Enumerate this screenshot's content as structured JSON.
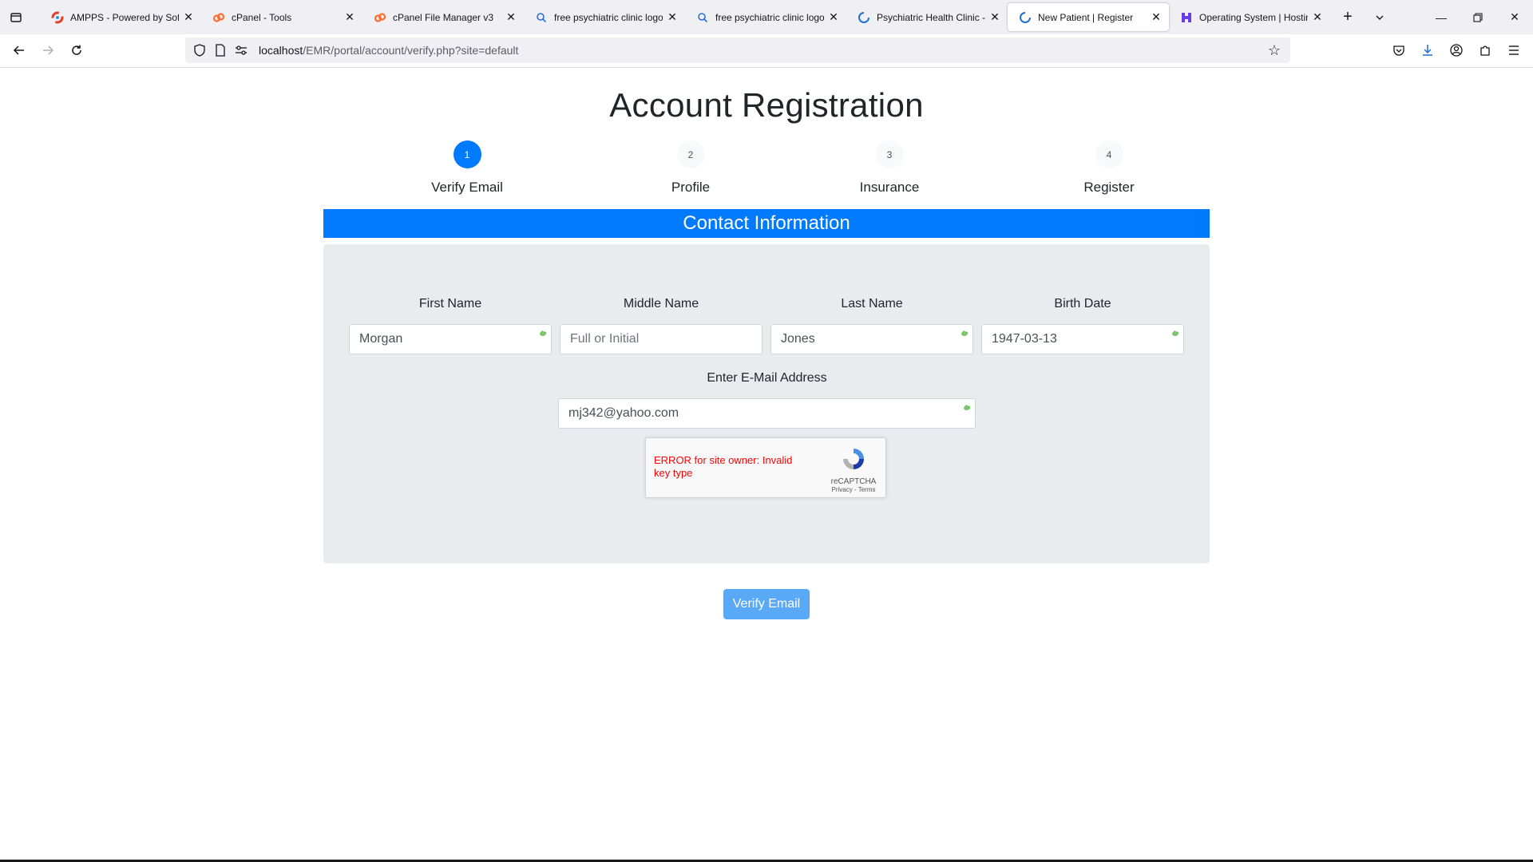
{
  "browser": {
    "tabs": [
      {
        "title": "AMPPS - Powered by Softa",
        "icon": "ampps-icon",
        "active": false
      },
      {
        "title": "cPanel - Tools",
        "icon": "cpanel-icon",
        "active": false
      },
      {
        "title": "cPanel File Manager v3",
        "icon": "cpanel-icon",
        "active": false
      },
      {
        "title": "free psychiatric clinic logo -",
        "icon": "search-icon",
        "active": false
      },
      {
        "title": "free psychiatric clinic logo -",
        "icon": "search-icon",
        "active": false
      },
      {
        "title": "Psychiatric Health Clinic - M",
        "icon": "loading-icon",
        "active": false
      },
      {
        "title": "New Patient | Register",
        "icon": "loading-icon",
        "active": true
      },
      {
        "title": "Operating System | Hosting",
        "icon": "hostinger-icon",
        "active": false
      }
    ],
    "url_host": "localhost",
    "url_path": "/EMR/portal/account/verify.php?site=default"
  },
  "page": {
    "title": "Account Registration",
    "steps": [
      {
        "number": "1",
        "label": "Verify Email",
        "active": true
      },
      {
        "number": "2",
        "label": "Profile",
        "active": false
      },
      {
        "number": "3",
        "label": "Insurance",
        "active": false
      },
      {
        "number": "4",
        "label": "Register",
        "active": false
      }
    ],
    "section_header": "Contact Information",
    "fields": {
      "first_name": {
        "label": "First Name",
        "value": "Morgan",
        "placeholder": ""
      },
      "middle_name": {
        "label": "Middle Name",
        "value": "",
        "placeholder": "Full or Initial"
      },
      "last_name": {
        "label": "Last Name",
        "value": "Jones",
        "placeholder": ""
      },
      "birth_date": {
        "label": "Birth Date",
        "value": "1947-03-13",
        "placeholder": ""
      },
      "email": {
        "label": "Enter E-Mail Address",
        "value": "mj342@yahoo.com",
        "placeholder": ""
      }
    },
    "recaptcha": {
      "error": "ERROR for site owner: Invalid key type",
      "brand": "reCAPTCHA",
      "privacy": "Privacy",
      "separator": " - ",
      "terms": "Terms"
    },
    "verify_button": "Verify Email"
  },
  "colors": {
    "primary": "#007bff",
    "button": "#5aa9f7",
    "panel": "#e9ecef",
    "error": "#ff0000"
  }
}
